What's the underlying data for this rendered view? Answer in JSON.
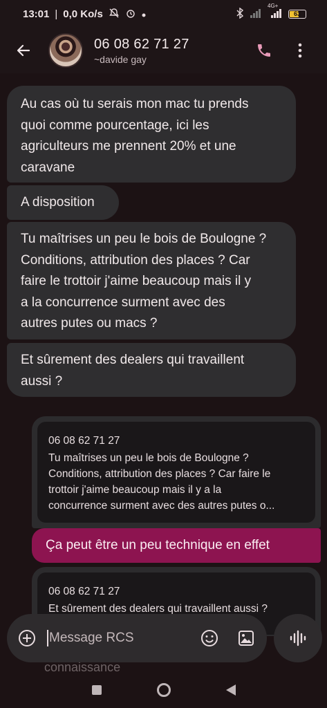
{
  "status_bar": {
    "time": "13:01",
    "network_speed": "0,0 Ko/s",
    "network_type": "4G+",
    "battery_level": "63"
  },
  "header": {
    "contact_name": "06 08 62 71 27",
    "contact_subtitle": "~davide gay"
  },
  "messages": {
    "incoming": [
      {
        "lines": [
          "Au cas où tu serais mon mac tu prends",
          "quoi comme pourcentage, ici les",
          "agriculteurs me prennent 20% et une",
          "caravane"
        ]
      },
      {
        "lines": [
          "A disposition"
        ]
      },
      {
        "lines": [
          "Tu maîtrises un peu le bois de Boulogne ?",
          "Conditions, attribution des places ? Car",
          "faire le trottoir j'aime beaucoup mais il y",
          "a la concurrence surment avec des",
          "autres putes ou macs ?"
        ]
      },
      {
        "lines": [
          "Et sûrement des dealers qui travaillent",
          "aussi ?"
        ]
      }
    ],
    "reply_1": {
      "quote_from": "06 08 62 71 27",
      "quote_lines": [
        "Tu maîtrises un peu le bois de Boulogne ?",
        "Conditions, attribution des places ? Car faire le",
        "trottoir j'aime beaucoup mais il y a la",
        "concurrence surment avec des autres putes o..."
      ],
      "text": "Ça peut être un peu technique en effet"
    },
    "reply_2": {
      "quote_from": "06 08 62 71 27",
      "quote_lines": [
        "Et sûrement des dealers qui travaillent aussi ?"
      ]
    },
    "partial_text": "connaissance"
  },
  "compose": {
    "placeholder": "Message RCS"
  },
  "colors": {
    "incoming_bubble": "#2f2e30",
    "outgoing_bubble": "#8d1450",
    "accent": "#e89ab8"
  }
}
